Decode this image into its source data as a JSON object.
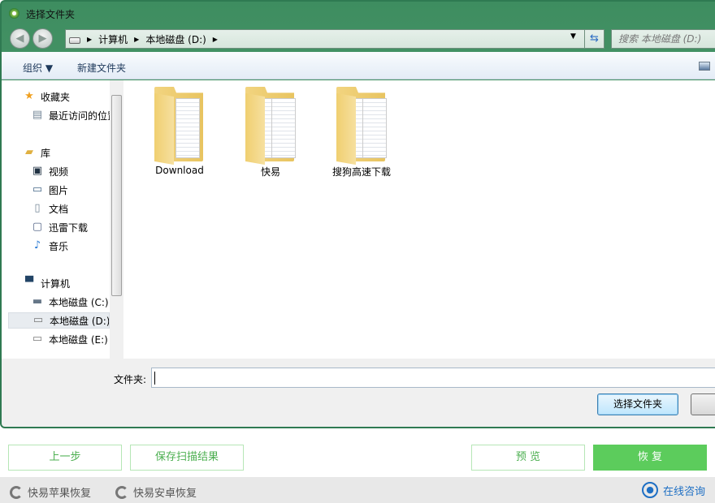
{
  "dialog": {
    "title": "选择文件夹",
    "address": {
      "crumbs": [
        "计算机",
        "本地磁盘 (D:)"
      ]
    },
    "search_placeholder": "搜索 本地磁盘 (D:)",
    "toolbar": {
      "organize": "组织 ▼",
      "new_folder": "新建文件夹"
    },
    "sidebar": [
      {
        "label": "收藏夹",
        "icon": "star-icon"
      },
      {
        "label": "最近访问的位置",
        "icon": "recent-places-icon"
      },
      {
        "label": "库",
        "icon": "library-icon"
      },
      {
        "label": "视频",
        "icon": "video-icon"
      },
      {
        "label": "图片",
        "icon": "picture-icon"
      },
      {
        "label": "文档",
        "icon": "document-icon"
      },
      {
        "label": "迅雷下载",
        "icon": "download-icon"
      },
      {
        "label": "音乐",
        "icon": "music-icon"
      },
      {
        "label": "计算机",
        "icon": "computer-icon"
      },
      {
        "label": "本地磁盘 (C:)",
        "icon": "system-drive-icon"
      },
      {
        "label": "本地磁盘 (D:)",
        "icon": "drive-icon",
        "selected": true
      },
      {
        "label": "本地磁盘 (E:)",
        "icon": "drive-icon"
      }
    ],
    "folders": [
      "Download",
      "快易",
      "搜狗高速下载"
    ],
    "folder_label": "文件夹:",
    "folder_value": "",
    "ok_button": "选择文件夹"
  },
  "app": {
    "back": "上一步",
    "save_scan": "保存扫描结果",
    "preview": "预 览",
    "restore": "恢 复",
    "footer": {
      "apple": "快易苹果恢复",
      "android": "快易安卓恢复",
      "consult": "在线咨询"
    },
    "accent": "#5ccc5c"
  }
}
